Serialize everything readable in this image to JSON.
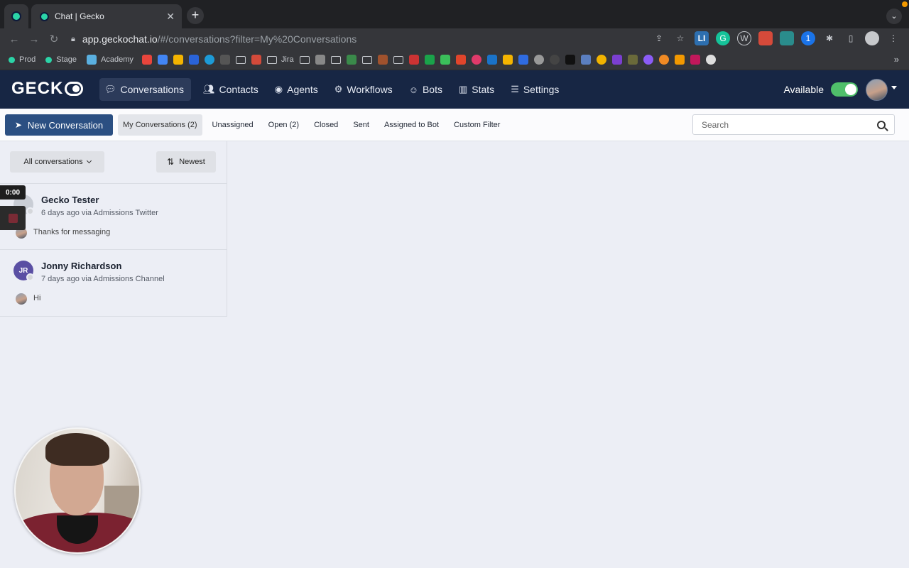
{
  "browser": {
    "tab_title": "Chat | Gecko",
    "url_host": "app.geckochat.io",
    "url_path": "/#/conversations?filter=My%20Conversations",
    "bookmarks": [
      {
        "label": "Prod",
        "icon": "gecko-dot-icon"
      },
      {
        "label": "Stage",
        "icon": "gecko-dot-icon"
      },
      {
        "label": "Academy",
        "icon": "academy-icon"
      },
      {
        "label": "Jira",
        "icon": "folder-icon"
      }
    ]
  },
  "app": {
    "logo": "GECK",
    "nav": [
      {
        "label": "Conversations",
        "icon": "chat-icon",
        "active": true
      },
      {
        "label": "Contacts",
        "icon": "users-icon"
      },
      {
        "label": "Agents",
        "icon": "agent-icon"
      },
      {
        "label": "Workflows",
        "icon": "gears-icon"
      },
      {
        "label": "Bots",
        "icon": "bot-icon"
      },
      {
        "label": "Stats",
        "icon": "bar-chart-icon"
      },
      {
        "label": "Settings",
        "icon": "sliders-icon"
      }
    ],
    "availability_label": "Available"
  },
  "filterbar": {
    "new_conversation": "New Conversation",
    "filters": [
      {
        "label": "My Conversations (2)",
        "active": true
      },
      {
        "label": "Unassigned"
      },
      {
        "label": "Open (2)"
      },
      {
        "label": "Closed"
      },
      {
        "label": "Sent"
      },
      {
        "label": "Assigned to Bot"
      },
      {
        "label": "Custom Filter"
      }
    ],
    "search_placeholder": "Search"
  },
  "list": {
    "scope_label": "All conversations",
    "sort_label": "Newest",
    "conversations": [
      {
        "name": "Gecko Tester",
        "initials": "",
        "meta": "6 days ago via Admissions Twitter",
        "preview": "Thanks for messaging"
      },
      {
        "name": "Jonny Richardson",
        "initials": "JR",
        "meta": "7 days ago via Admissions Channel",
        "preview": "Hi"
      }
    ]
  },
  "recorder": {
    "timer": "0:00"
  },
  "colors": {
    "header_bg": "#172644",
    "primary_button": "#2b4f82",
    "toggle_on": "#4fbf6a",
    "jr_avatar": "#5a4fa3"
  }
}
